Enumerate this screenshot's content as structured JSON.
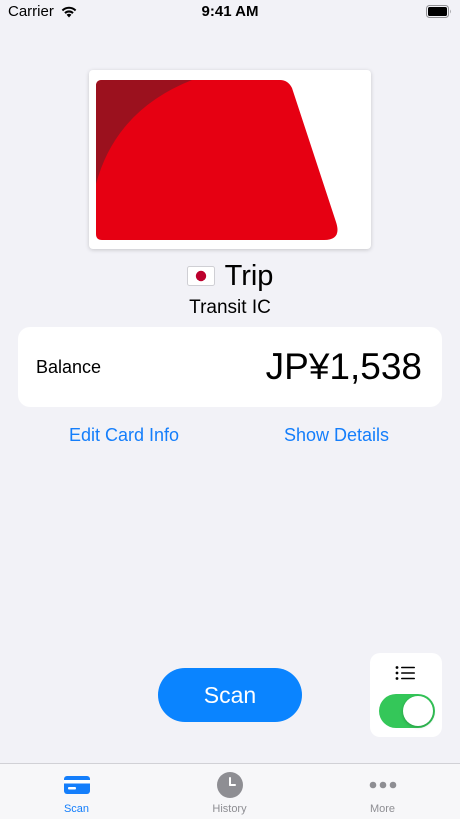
{
  "status_bar": {
    "carrier": "Carrier",
    "time": "9:41 AM"
  },
  "card": {
    "flag": "🇯🇵",
    "name": "Trip",
    "type": "Transit IC",
    "art_colors": {
      "primary": "#e60012",
      "dark": "#9b111e"
    }
  },
  "balance": {
    "label": "Balance",
    "value": "JP¥1,538"
  },
  "links": {
    "edit": "Edit Card Info",
    "details": "Show Details"
  },
  "scan_button": {
    "label": "Scan"
  },
  "mode_toggle": {
    "on": true,
    "icon": "list-icon"
  },
  "tabs": [
    {
      "label": "Scan",
      "icon": "card-icon",
      "active": true
    },
    {
      "label": "History",
      "icon": "clock-icon",
      "active": false
    },
    {
      "label": "More",
      "icon": "ellipsis-icon",
      "active": false
    }
  ],
  "colors": {
    "accent": "#147efb",
    "button": "#0a84ff",
    "toggle_on": "#34c759",
    "background": "#f2f2f7"
  }
}
